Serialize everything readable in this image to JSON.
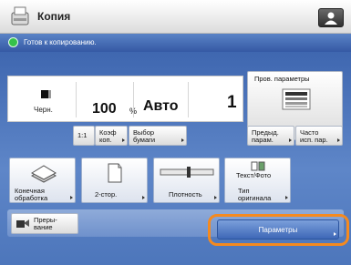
{
  "header": {
    "title": "Копия"
  },
  "status": {
    "text": "Готов к копированию."
  },
  "display": {
    "color_mode": "Черн.",
    "zoom_value": "100",
    "zoom_unit": "%",
    "paper_value": "Авто",
    "copies": "1"
  },
  "buttons": {
    "ratio_1to1": "1:1",
    "zoom": [
      "Коэф",
      "коп."
    ],
    "paper_select": [
      "Выбор",
      "бумаги"
    ],
    "preview_settings": "Пров. параметры",
    "previous_settings": [
      "Предыд.",
      "парам."
    ],
    "frequent_settings": [
      "Часто",
      "исп. пар."
    ]
  },
  "functions": {
    "finishing": [
      "Конечная",
      "обработка"
    ],
    "duplex": "2-стор.",
    "density": "Плотность",
    "original_type_icon_text": "Текст/Фото",
    "original_type": [
      "Тип",
      "оригинала"
    ]
  },
  "bottom": {
    "interrupt": [
      "Преры-",
      "вание"
    ],
    "parameters": "Параметры"
  }
}
